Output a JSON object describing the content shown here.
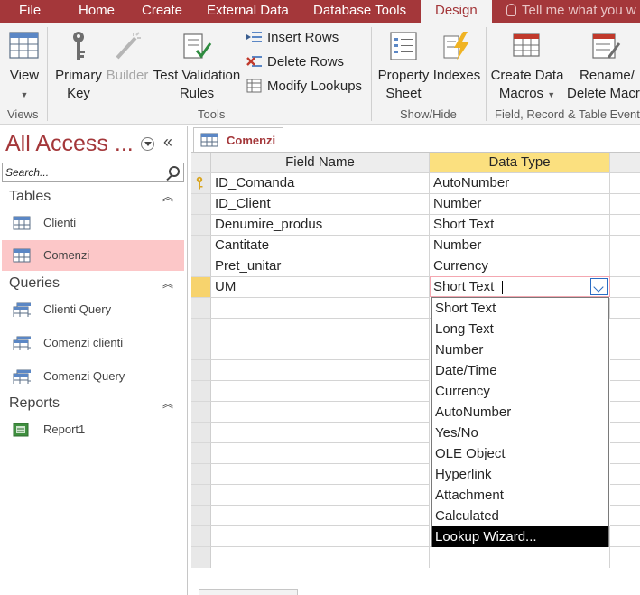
{
  "ribbon_tabs": [
    {
      "label": "File"
    },
    {
      "label": "Home"
    },
    {
      "label": "Create"
    },
    {
      "label": "External Data"
    },
    {
      "label": "Database Tools"
    },
    {
      "label": "Design"
    },
    {
      "label": "Tell me what you w"
    }
  ],
  "active_tab": "Design",
  "ribbon": {
    "view": {
      "label": "View",
      "icon": "datasheet-view-icon"
    },
    "primary_key": {
      "label_line1": "Primary",
      "label_line2": "Key",
      "icon": "key-icon"
    },
    "builder": {
      "label": "Builder",
      "icon": "wand-icon",
      "enabled": false
    },
    "test_validation": {
      "label_line1": "Test Validation",
      "label_line2": "Rules",
      "icon": "validation-check-icon"
    },
    "insert_rows": {
      "label": "Insert Rows",
      "icon": "insert-rows-icon"
    },
    "delete_rows": {
      "label": "Delete Rows",
      "icon": "delete-rows-icon"
    },
    "modify_lookups": {
      "label": "Modify Lookups",
      "icon": "lookup-icon"
    },
    "property_sheet": {
      "label_line1": "Property",
      "label_line2": "Sheet",
      "icon": "property-sheet-icon"
    },
    "indexes": {
      "label": "Indexes",
      "icon": "lightning-icon"
    },
    "create_data_macros": {
      "label_line1": "Create Data",
      "label_line2": "Macros",
      "icon": "data-macro-icon"
    },
    "rename_delete_macro": {
      "label_line1": "Rename/",
      "label_line2": "Delete Macr",
      "icon": "rename-macro-icon"
    },
    "groups": {
      "views": "Views",
      "tools": "Tools",
      "show_hide": "Show/Hide",
      "field_record_table": "Field, Record & Table Event"
    }
  },
  "nav_pane": {
    "title": "All Access ...",
    "search_placeholder": "Search...",
    "sections": [
      {
        "label": "Tables",
        "items": [
          {
            "label": "Clienti",
            "icon": "table-icon",
            "selected": false
          },
          {
            "label": "Comenzi",
            "icon": "table-icon",
            "selected": true
          }
        ]
      },
      {
        "label": "Queries",
        "items": [
          {
            "label": "Clienti Query",
            "icon": "query-icon"
          },
          {
            "label": "Comenzi clienti",
            "icon": "query-icon"
          },
          {
            "label": "Comenzi Query",
            "icon": "query-icon"
          }
        ]
      },
      {
        "label": "Reports",
        "items": [
          {
            "label": "Report1",
            "icon": "report-icon"
          }
        ]
      }
    ]
  },
  "document": {
    "tab_label": "Comenzi",
    "columns": {
      "field_name": "Field Name",
      "data_type": "Data Type"
    },
    "rows": [
      {
        "field": "ID_Comanda",
        "type": "AutoNumber",
        "primary_key": true
      },
      {
        "field": "ID_Client",
        "type": "Number"
      },
      {
        "field": "Denumire_produs",
        "type": "Short Text"
      },
      {
        "field": "Cantitate",
        "type": "Number"
      },
      {
        "field": "Pret_unitar",
        "type": "Currency"
      },
      {
        "field": "UM",
        "type": "Short Text",
        "current": true
      }
    ],
    "data_type_options": [
      "Short Text",
      "Long Text",
      "Number",
      "Date/Time",
      "Currency",
      "AutoNumber",
      "Yes/No",
      "OLE Object",
      "Hyperlink",
      "Attachment",
      "Calculated",
      "Lookup Wizard..."
    ],
    "highlighted_option": "Lookup Wizard..."
  },
  "colors": {
    "accent": "#a4373a",
    "selection": "#fcc7c8",
    "header_active": "#fbe07f"
  }
}
